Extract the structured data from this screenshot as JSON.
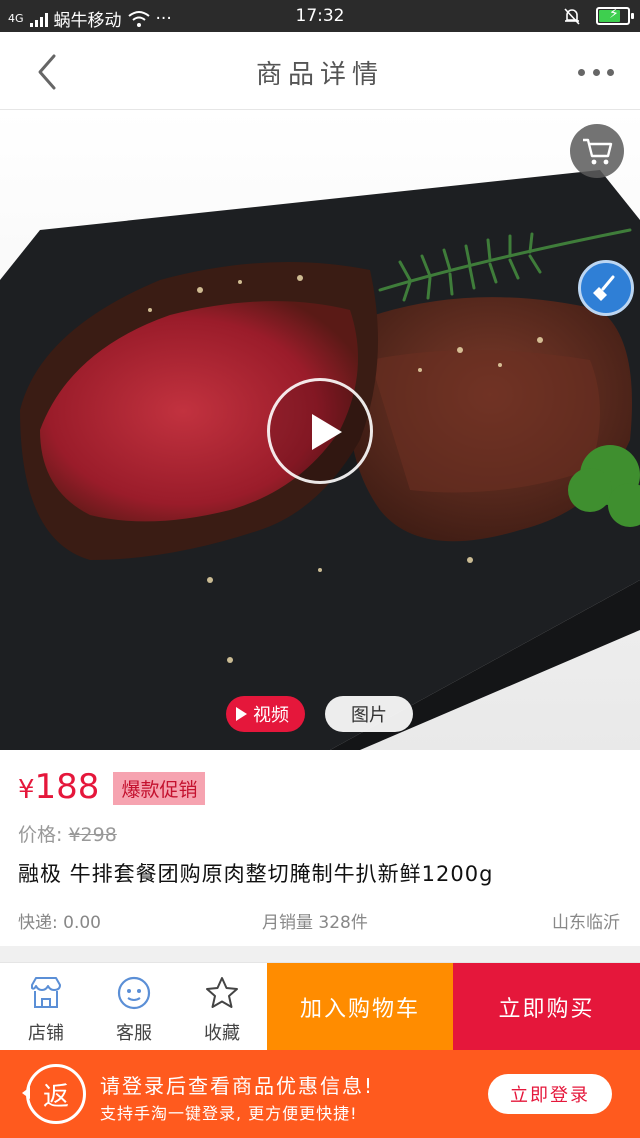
{
  "status_bar": {
    "network": "4G",
    "carrier": "蜗牛移动",
    "dots": "···",
    "time": "17:32"
  },
  "header": {
    "title": "商品详情",
    "back_icon": "chevron-left-icon",
    "more_icon": "more-dots-icon"
  },
  "hero": {
    "image_icon": "steak-photo",
    "media_tabs": {
      "video": "视频",
      "photo": "图片"
    },
    "selected_tab": "video"
  },
  "product": {
    "price_symbol": "¥",
    "price": "188",
    "promo_tag": "爆款促销",
    "original_label": "价格:",
    "original_price": "¥298",
    "title": "融极 牛排套餐团购原肉整切腌制牛扒新鲜1200g",
    "shipping": "快递: 0.00",
    "monthly_sales": "月销量 328件",
    "location": "山东临沂"
  },
  "bottom_bar": {
    "store_label": "店铺",
    "service_label": "客服",
    "favorite_label": "收藏",
    "add_to_cart": "加入购物车",
    "buy_now": "立即购买"
  },
  "login_banner": {
    "badge": "返",
    "line1": "请登录后查看商品优惠信息!",
    "line2": "支持手淘一键登录, 更方便更快捷!",
    "button": "立即登录"
  },
  "colors": {
    "accent_red": "#e5173b",
    "cart_orange": "#ff8c00",
    "banner_orange": "#ff5a1e",
    "promo_pink": "#f6a3b0"
  }
}
